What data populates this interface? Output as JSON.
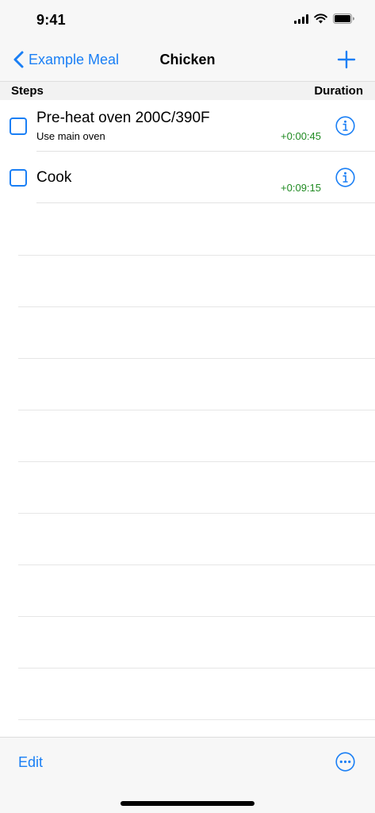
{
  "status_bar": {
    "time": "9:41"
  },
  "nav": {
    "back_label": "Example Meal",
    "title": "Chicken",
    "add_icon": "plus-icon"
  },
  "table_header": {
    "steps_label": "Steps",
    "duration_label": "Duration"
  },
  "steps": [
    {
      "title": "Pre-heat oven 200C/390F",
      "note": "Use main oven",
      "duration": "+0:00:45",
      "checked": false
    },
    {
      "title": "Cook",
      "note": "",
      "duration": "+0:09:15",
      "checked": false
    }
  ],
  "toolbar": {
    "edit_label": "Edit",
    "more_icon": "ellipsis-circle-icon"
  },
  "colors": {
    "accent": "#1a7ff5",
    "duration_green": "#1f8a21",
    "bar_background": "#f7f7f7"
  }
}
